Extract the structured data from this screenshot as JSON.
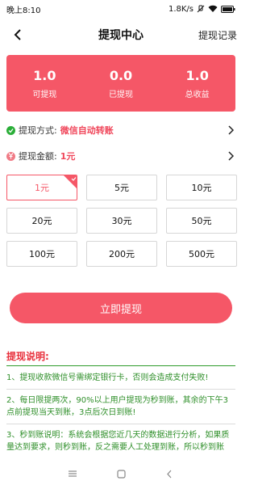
{
  "status_bar": {
    "time": "晚上8:10",
    "speed": "1.8K/s"
  },
  "header": {
    "title": "提现中心",
    "action_label": "提现记录"
  },
  "summary": [
    {
      "value": "1.0",
      "label": "可提现"
    },
    {
      "value": "0.0",
      "label": "已提现"
    },
    {
      "value": "1.0",
      "label": "总收益"
    }
  ],
  "method": {
    "label": "提现方式:",
    "value": "微信自动转账"
  },
  "amount_row": {
    "label": "提现金额:",
    "value": "1元"
  },
  "amounts": [
    "1元",
    "5元",
    "10元",
    "20元",
    "30元",
    "50元",
    "100元",
    "200元",
    "500元"
  ],
  "submit_label": "立即提现",
  "notes": {
    "title": "提现说明:",
    "items": [
      "1、提现收款微信号需绑定银行卡，否则会造成支付失败!",
      "2、每日限提两次，90%以上用户提现为秒到账，其余的下午3点前提现当天到账，3点后次日到账!",
      "3、秒到账说明：系统会根据您近几天的数据进行分析，如果质量达到要求，则秒到账，反之需要人工处理到账，所以秒到账"
    ]
  },
  "colors": {
    "accent": "#f55767",
    "notes_text": "#2f8f2a",
    "notes_title": "#e8303c"
  }
}
